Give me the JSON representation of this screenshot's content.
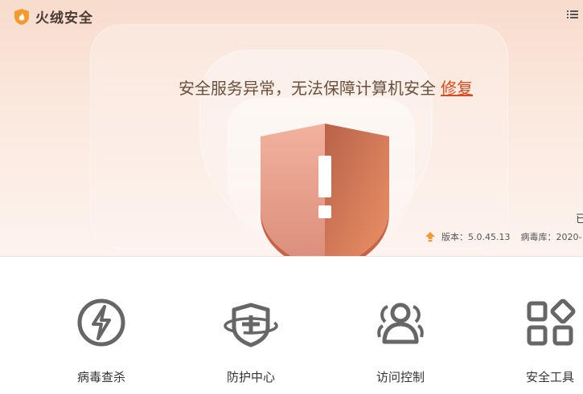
{
  "app": {
    "name": "火绒安全"
  },
  "alert": {
    "message": "安全服务异常，无法保障计算机安全",
    "fix_label": "修复"
  },
  "status_partial": "已",
  "version": {
    "version_label": "版本：5.0.45.13",
    "virus_db_label": "病毒库：2020-"
  },
  "tools": [
    {
      "label": "病毒查杀",
      "icon": "lightning-circle-icon"
    },
    {
      "label": "防护中心",
      "icon": "shield-plus-icon"
    },
    {
      "label": "访问控制",
      "icon": "users-icon"
    },
    {
      "label": "安全工具",
      "icon": "grid-apps-icon"
    }
  ],
  "colors": {
    "accent": "#d94a1c",
    "shield_left": "#e9a48f",
    "shield_right": "#c86a4e",
    "icon_gray": "#666666"
  }
}
